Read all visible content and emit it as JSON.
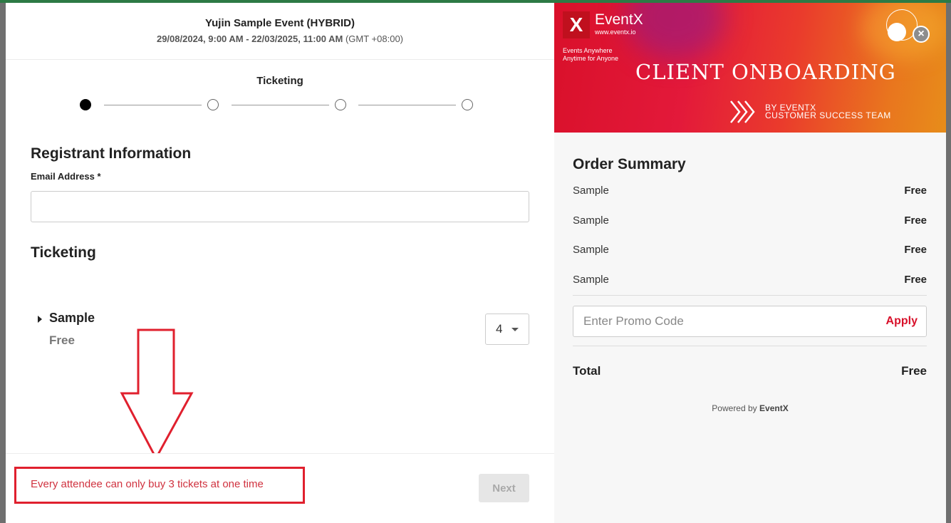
{
  "event": {
    "title": "Yujin Sample Event (HYBRID)",
    "dates": "29/08/2024, 9:00 AM - 22/03/2025, 11:00 AM",
    "timezone": "(GMT +08:00)"
  },
  "stepper": {
    "current_label": "Ticketing",
    "steps": 4,
    "active_index": 0
  },
  "registrant": {
    "section_title": "Registrant Information",
    "email_label": "Email Address *",
    "email_value": ""
  },
  "ticketing": {
    "section_title": "Ticketing",
    "tickets": [
      {
        "name": "Sample",
        "price": "Free",
        "quantity": "4"
      }
    ]
  },
  "footer": {
    "error_message": "Every attendee can only buy 3 tickets at one time",
    "next_label": "Next"
  },
  "banner": {
    "logo_letter": "X",
    "logo_text": "EventX",
    "logo_url": "www.eventx.io",
    "tagline": "Events Anywhere Anytime for Anyone",
    "title": "CLIENT ONBOARDING",
    "subtitle_line1": "BY EVENTX",
    "subtitle_line2": "CUSTOMER SUCCESS TEAM"
  },
  "summary": {
    "title": "Order Summary",
    "items": [
      {
        "name": "Sample",
        "price": "Free"
      },
      {
        "name": "Sample",
        "price": "Free"
      },
      {
        "name": "Sample",
        "price": "Free"
      },
      {
        "name": "Sample",
        "price": "Free"
      }
    ],
    "promo_placeholder": "Enter Promo Code",
    "apply_label": "Apply",
    "total_label": "Total",
    "total_value": "Free",
    "powered_prefix": "Powered by",
    "powered_brand": "EventX"
  },
  "colors": {
    "accent_red": "#d8102a",
    "error_red": "#e0202e",
    "active_step": "#000000"
  }
}
